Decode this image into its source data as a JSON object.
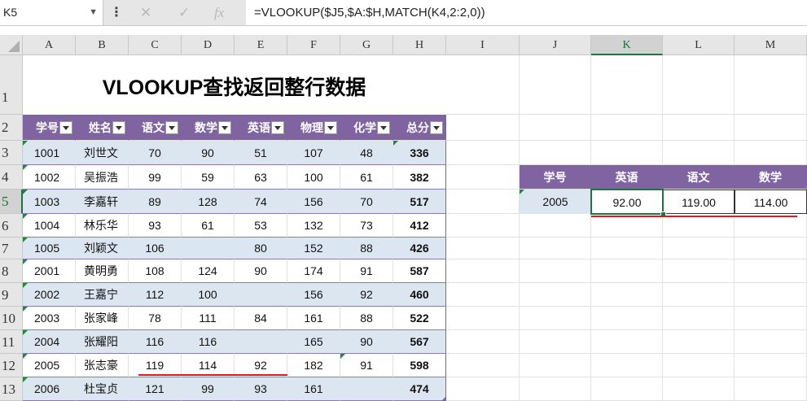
{
  "formula_bar": {
    "name_box": "K5",
    "fx": "fx",
    "formula": "=VLOOKUP($J5,$A:$H,MATCH(K4,2:2,0))"
  },
  "columns": [
    "A",
    "B",
    "C",
    "D",
    "E",
    "F",
    "G",
    "H",
    "I",
    "J",
    "K",
    "L",
    "M"
  ],
  "rows": [
    "1",
    "2",
    "3",
    "4",
    "5",
    "6",
    "7",
    "8",
    "9",
    "10",
    "11",
    "12",
    "13"
  ],
  "title": "VLOOKUP查找返回整行数据",
  "table": {
    "headers": [
      "学号",
      "姓名",
      "语文",
      "数学",
      "英语",
      "物理",
      "化学",
      "总分"
    ],
    "data": [
      [
        "1001",
        "刘世文",
        "70",
        "90",
        "51",
        "107",
        "48",
        "336"
      ],
      [
        "1002",
        "吴振浩",
        "99",
        "59",
        "63",
        "100",
        "61",
        "382"
      ],
      [
        "1003",
        "李嘉轩",
        "89",
        "128",
        "74",
        "156",
        "70",
        "517"
      ],
      [
        "1004",
        "林乐华",
        "93",
        "61",
        "53",
        "132",
        "73",
        "412"
      ],
      [
        "1005",
        "刘颖文",
        "106",
        "",
        "80",
        "152",
        "88",
        "426"
      ],
      [
        "2001",
        "黄明勇",
        "108",
        "124",
        "90",
        "174",
        "91",
        "587"
      ],
      [
        "2002",
        "王嘉宁",
        "112",
        "100",
        "",
        "156",
        "92",
        "460"
      ],
      [
        "2003",
        "张家峰",
        "78",
        "111",
        "84",
        "161",
        "88",
        "522"
      ],
      [
        "2004",
        "张耀阳",
        "116",
        "116",
        "",
        "165",
        "90",
        "567"
      ],
      [
        "2005",
        "张志豪",
        "119",
        "114",
        "92",
        "182",
        "91",
        "598"
      ],
      [
        "2006",
        "杜宝贞",
        "121",
        "99",
        "93",
        "161",
        "",
        "474"
      ]
    ]
  },
  "lookup": {
    "headers": [
      "学号",
      "英语",
      "语文",
      "数学"
    ],
    "values": [
      "2005",
      "92.00",
      "119.00",
      "114.00"
    ]
  },
  "colors": {
    "header_purple": "#8064a2",
    "band_blue": "#dce6f1",
    "excel_green": "#217346",
    "red_underline": "#e0191e"
  }
}
